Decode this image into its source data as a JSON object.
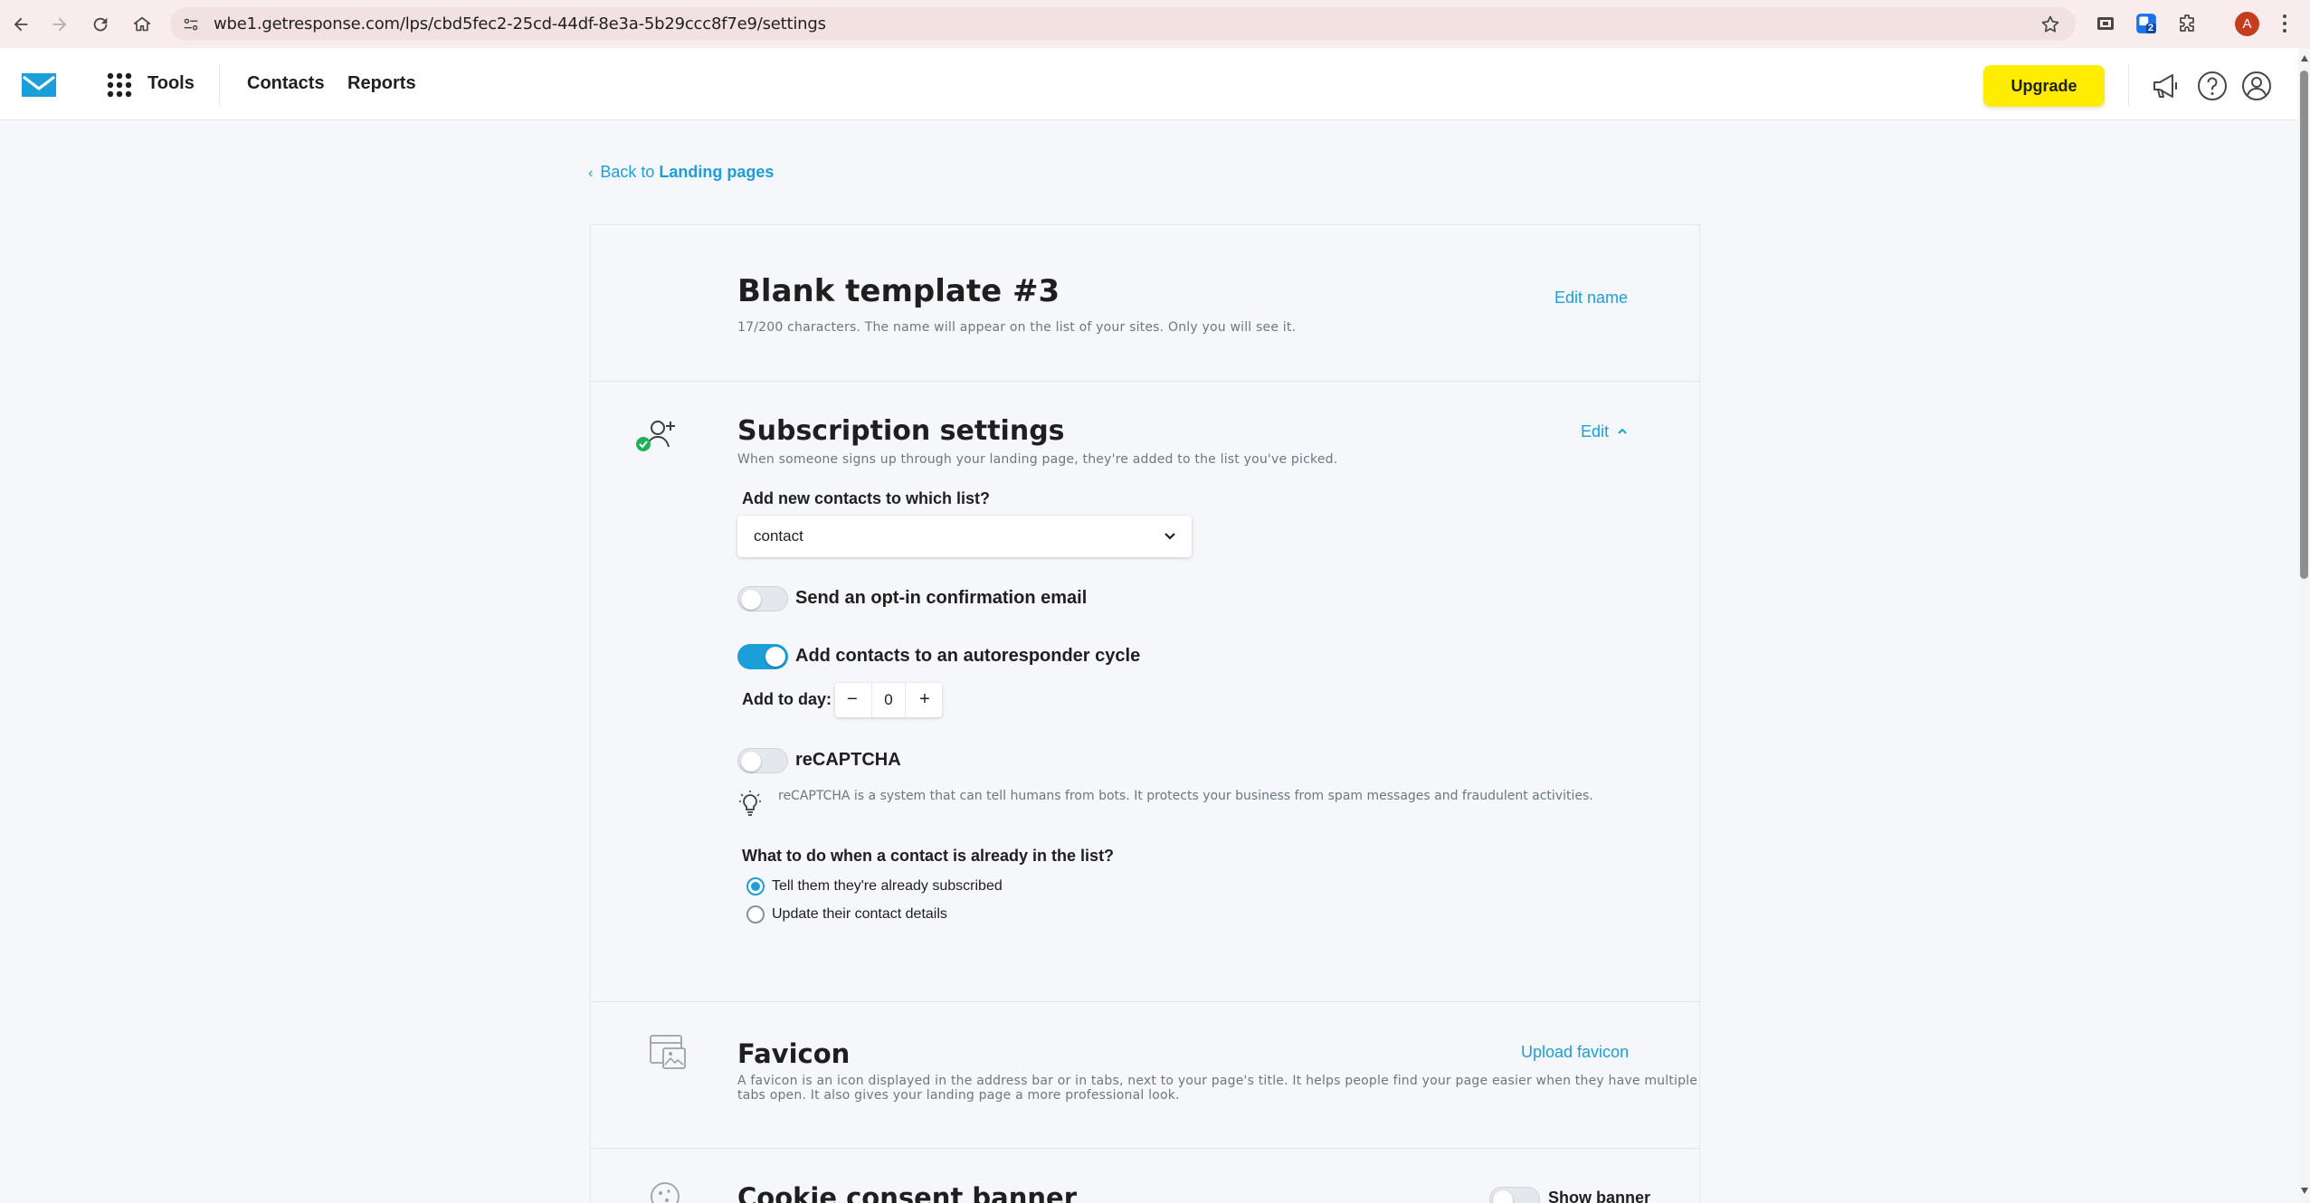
{
  "browser": {
    "url": "wbe1.getresponse.com/lps/cbd5fec2-25cd-44df-8e3a-5b29ccc8f7e9/settings",
    "profile_initial": "A",
    "extension_badge": "2"
  },
  "header": {
    "tools_label": "Tools",
    "contacts_label": "Contacts",
    "reports_label": "Reports",
    "upgrade_label": "Upgrade"
  },
  "back": {
    "prefix": "Back to",
    "link": "Landing pages"
  },
  "page_name": {
    "title": "Blank template #3",
    "description": "17/200 characters. The name will appear on the list of your sites. Only you will see it.",
    "action": "Edit name"
  },
  "subscription": {
    "title": "Subscription settings",
    "description": "When someone signs up through your landing page, they're added to the list you've picked.",
    "action": "Edit",
    "list_label": "Add new contacts to which list?",
    "list_value": "contact",
    "optin_label": "Send an opt-in confirmation email",
    "optin_on": false,
    "autoresponder_label": "Add contacts to an autoresponder cycle",
    "autoresponder_on": true,
    "add_to_day_label": "Add to day:",
    "add_to_day_value": "0",
    "minus": "−",
    "plus": "+",
    "recaptcha_label": "reCAPTCHA",
    "recaptcha_on": false,
    "recaptcha_hint": "reCAPTCHA is a system that can tell humans from bots. It protects your business from spam messages and fraudulent activities.",
    "duplicate_question": "What to do when a contact is already in the list?",
    "duplicate_options": [
      {
        "label": "Tell them they're already subscribed",
        "checked": true
      },
      {
        "label": "Update their contact details",
        "checked": false
      }
    ]
  },
  "favicon": {
    "title": "Favicon",
    "description_line1": "A favicon is an icon displayed in the address bar or in tabs, next to your page's title. It helps people find your page easier when they have multiple",
    "description_line2": "tabs open. It also gives your landing page a more professional look.",
    "action": "Upload favicon"
  },
  "cookie": {
    "title": "Cookie consent banner",
    "toggle_label": "Show banner",
    "toggle_on": false
  },
  "colors": {
    "accent": "#1a9fd8",
    "upgrade": "#ffec00",
    "success": "#1fb25a"
  }
}
